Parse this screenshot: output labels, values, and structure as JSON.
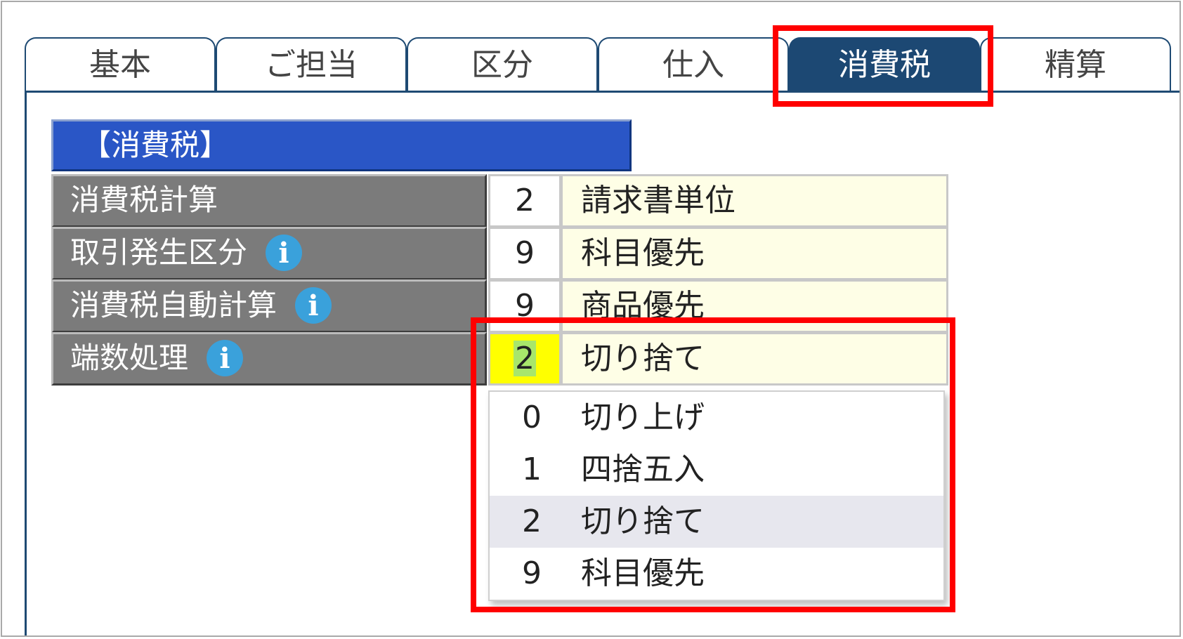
{
  "tabs": [
    {
      "label": "基本"
    },
    {
      "label": "ご担当"
    },
    {
      "label": "区分"
    },
    {
      "label": "仕入"
    },
    {
      "label": "消費税",
      "active": true
    },
    {
      "label": "精算"
    }
  ],
  "section": {
    "title": "【消費税】"
  },
  "rows": [
    {
      "label": "消費税計算",
      "code": "2",
      "value": "請求書単位",
      "info": false
    },
    {
      "label": "取引発生区分",
      "code": "9",
      "value": "科目優先",
      "info": true
    },
    {
      "label": "消費税自動計算",
      "code": "9",
      "value": "商品優先",
      "info": true
    },
    {
      "label": "端数処理",
      "code": "2",
      "value": "切り捨て",
      "info": true
    }
  ],
  "dropdown": {
    "options": [
      {
        "code": "0",
        "label": "切り上げ"
      },
      {
        "code": "1",
        "label": "四捨五入"
      },
      {
        "code": "2",
        "label": "切り捨て",
        "selected": true
      },
      {
        "code": "9",
        "label": "科目優先"
      }
    ]
  },
  "icons": {
    "info": "info-icon"
  },
  "colors": {
    "tab_active": "#1c4873",
    "section_header": "#2a56c6",
    "label_bg": "#7b7b7b",
    "value_bg": "#fefee6",
    "editing_bg": "#ffff00",
    "highlight": "#ff0000",
    "info_icon": "#3aa1db"
  },
  "info_glyph": "i"
}
